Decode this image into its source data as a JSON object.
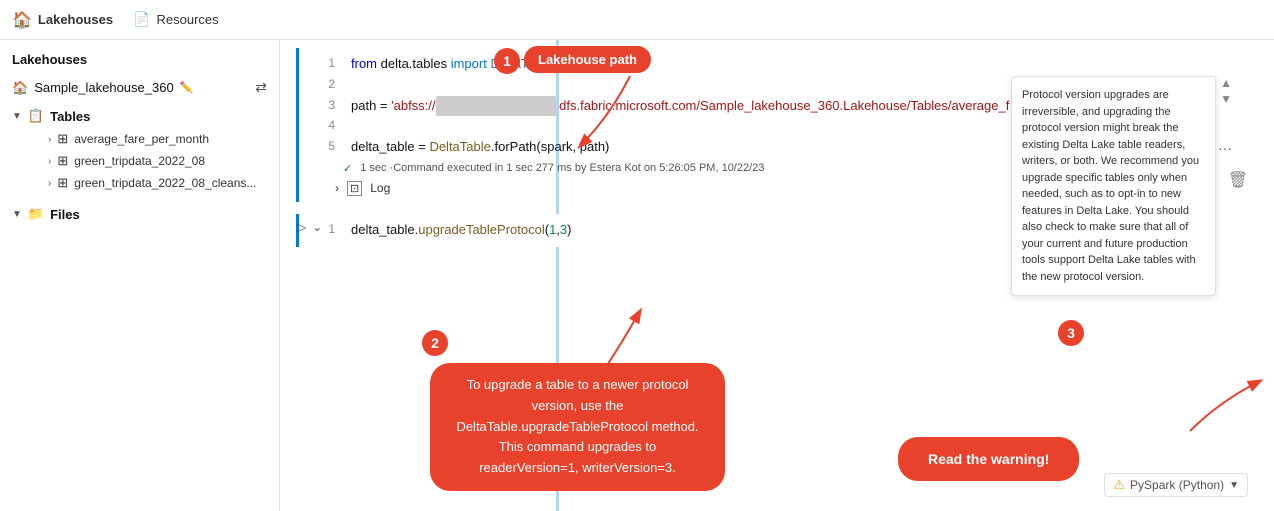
{
  "topbar": {
    "lakehouses_label": "Lakehouses",
    "resources_label": "Resources"
  },
  "sidebar": {
    "title": "Lakehouses",
    "lakehouse_name": "Sample_lakehouse_360",
    "sections": [
      {
        "label": "Tables",
        "items": [
          "average_fare_per_month",
          "green_tripdata_2022_08",
          "green_tripdata_2022_08_cleans..."
        ]
      },
      {
        "label": "Files",
        "items": []
      }
    ]
  },
  "code_cell1": {
    "lines": [
      {
        "num": "1",
        "content": "from delta.tables import DeltaTable"
      },
      {
        "num": "2",
        "content": ""
      },
      {
        "num": "3",
        "content": "path = 'abfss://[masked] dfs.fabric.microsoft.com/Sample_lakehouse_360.Lakehouse/Tables/average_f"
      },
      {
        "num": "4",
        "content": ""
      },
      {
        "num": "5",
        "content": "delta_table = DeltaTable.forPath(spark, path)"
      }
    ],
    "exec_info": "1 sec ·Command executed in 1 sec 277 ms by Estera Kot on 5:26:05 PM, 10/22/23",
    "log_label": "Log"
  },
  "code_cell2": {
    "lines": [
      {
        "num": "1",
        "content": "delta_table.upgradeTableProtocol(1,3)"
      }
    ]
  },
  "warning_box": {
    "text": "Protocol version upgrades are irreversible, and upgrading the protocol version might break the existing Delta Lake table readers, writers, or both. We recommend you upgrade specific tables only when needed, such as to opt-in to new features in Delta Lake. You should also check to make sure that all of your current and future production tools support Delta Lake tables with the new protocol version."
  },
  "pyspark_badge": {
    "label": "PySpark (Python)"
  },
  "callouts": {
    "num1": "1",
    "label1": "Lakehouse path",
    "num2": "2",
    "label2": "To upgrade a table to a newer protocol version, use the DeltaTable.upgradeTableProtocol method. This command upgrades to readerVersion=1, writerVersion=3.",
    "num3": "3",
    "label3": "Read the warning!"
  }
}
